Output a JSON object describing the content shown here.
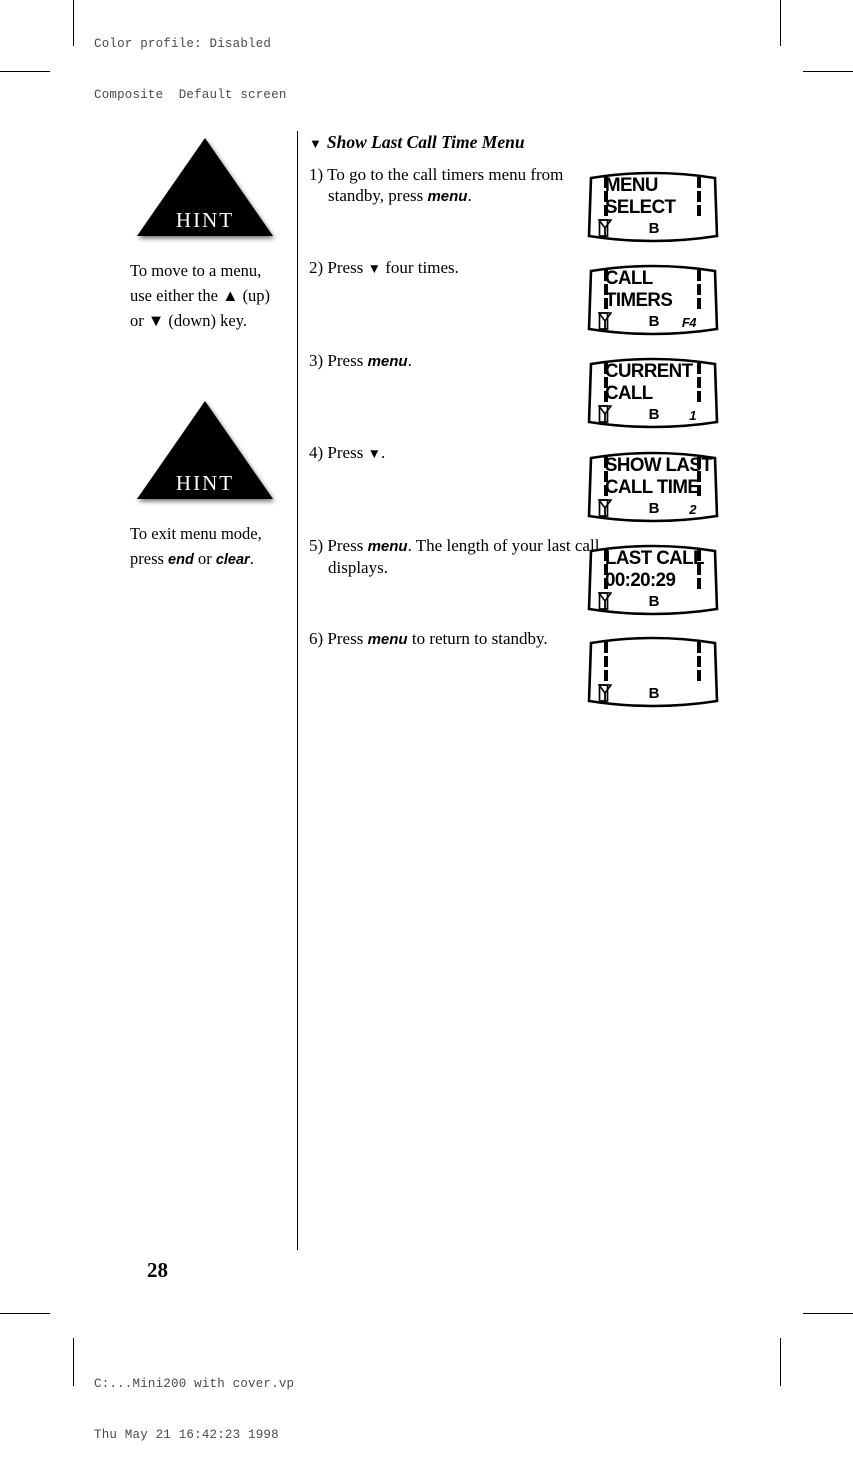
{
  "prepress": {
    "header_line1": "Color profile: Disabled",
    "header_line2": "Composite  Default screen",
    "footer_line1": "C:...Mini200 with cover.vp",
    "footer_line2": "Thu May 21 16:42:23 1998"
  },
  "page": {
    "number": "28"
  },
  "hints": [
    {
      "badge_label": "HINT",
      "line1_a": "To move to a menu,",
      "line2_a": "use either the ",
      "line2_key": "▲",
      "line2_b": " (up)",
      "line3_a": "or ",
      "line3_key": "▼",
      "line3_b": " (down) key."
    },
    {
      "badge_label": "HINT",
      "line1_a": "To exit menu mode,",
      "line2_a": "press ",
      "line2_key1": "end",
      "line2_mid": " or ",
      "line2_key2": "clear",
      "line2_b": "."
    }
  ],
  "section": {
    "marker": "▼",
    "title": "Show Last Call Time Menu"
  },
  "steps": [
    {
      "number": "1)",
      "text_a": "To go to the call timers menu from standby, press ",
      "key": "menu",
      "text_b": "."
    },
    {
      "number": "2)",
      "text_a": "Press ",
      "key": "▼",
      "text_b": " four times."
    },
    {
      "number": "3)",
      "text_a": "Press ",
      "key": "menu",
      "text_b": "."
    },
    {
      "number": "4)",
      "text_a": "Press ",
      "key": "▼",
      "text_b": "."
    },
    {
      "number": "5)",
      "text_a": "Press ",
      "key": "menu",
      "text_b": ". The length of your last call displays."
    },
    {
      "number": "6)",
      "text_a": "Press ",
      "key": "menu",
      "text_b": " to return to standby."
    }
  ],
  "displays": [
    {
      "name": "menu-select",
      "line1": "MENU",
      "line2": "SELECT",
      "status_b": "B",
      "status_num": "",
      "antenna_icon": "antenna-icon",
      "battery_icon": "battery-icon"
    },
    {
      "name": "call-timers",
      "line1": "CALL",
      "line2": "TIMERS",
      "status_b": "B",
      "status_num": "F4",
      "antenna_icon": "antenna-icon",
      "battery_icon": "battery-icon"
    },
    {
      "name": "current-call",
      "line1": "CURRENT",
      "line2": "CALL",
      "status_b": "B",
      "status_num": "1",
      "antenna_icon": "antenna-icon",
      "battery_icon": "battery-icon"
    },
    {
      "name": "show-last-call-time",
      "line1": "SHOW LAST",
      "line2": "CALL TIME",
      "status_b": "B",
      "status_num": "2",
      "antenna_icon": "antenna-icon",
      "battery_icon": "battery-icon"
    },
    {
      "name": "last-call-duration",
      "line1": "LAST CALL",
      "line2": "00:20:29",
      "status_b": "B",
      "status_num": "",
      "antenna_icon": "antenna-icon",
      "battery_icon": "battery-icon"
    },
    {
      "name": "standby-blank",
      "line1": "",
      "line2": "",
      "status_b": "B",
      "status_num": "",
      "antenna_icon": "antenna-icon",
      "battery_icon": "battery-icon"
    }
  ],
  "colors": {
    "ink": "#000000",
    "paper": "#ffffff",
    "prepress_gray": "#4a4a4a"
  }
}
